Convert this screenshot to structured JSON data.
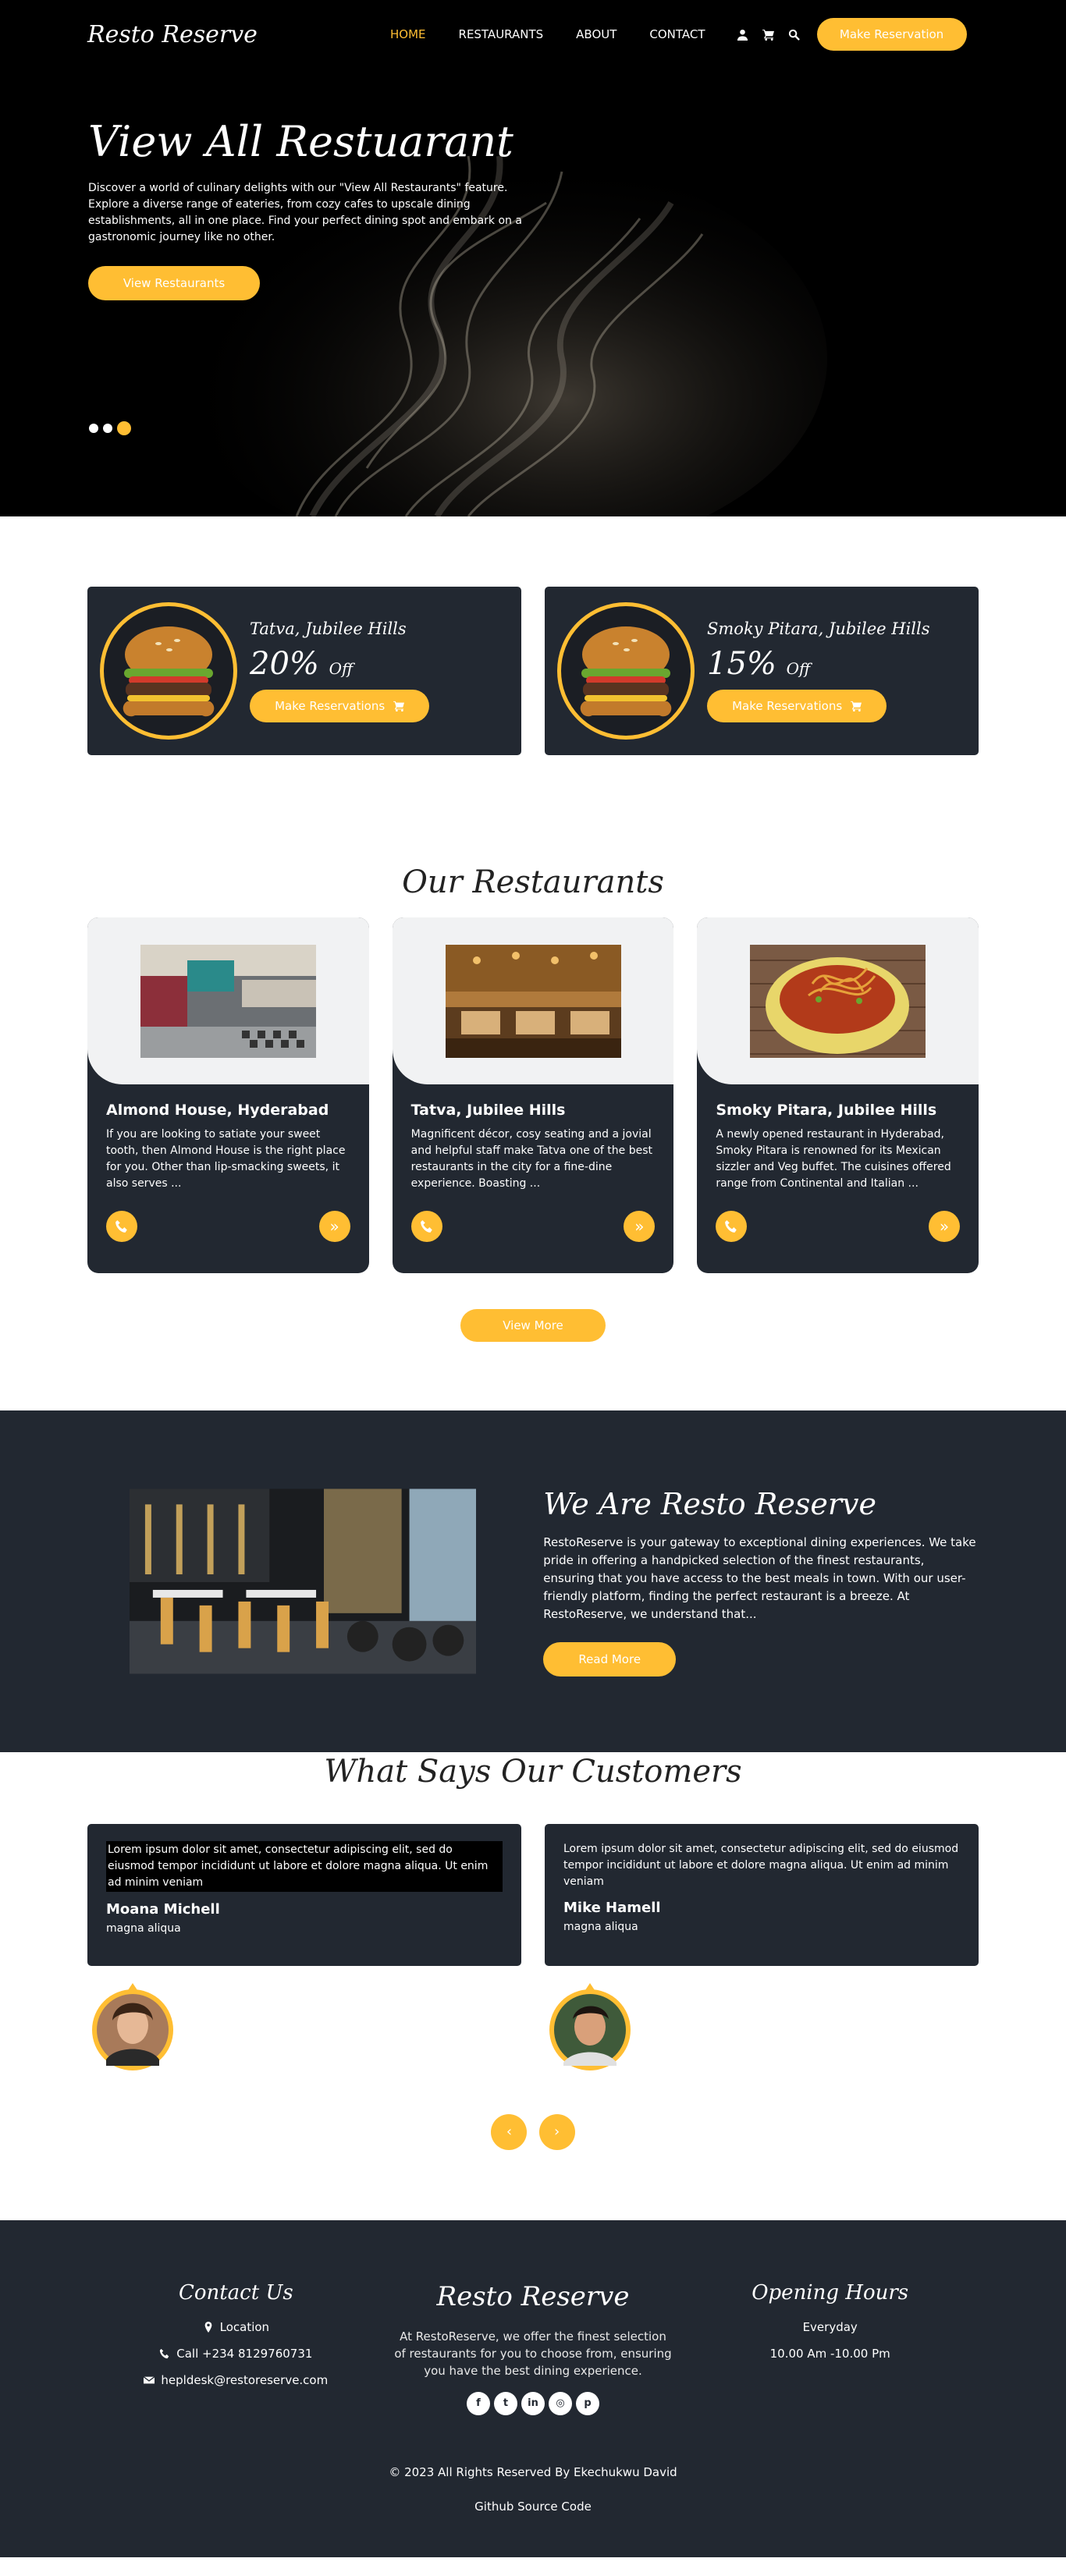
{
  "nav": {
    "brand": "Resto Reserve",
    "items": [
      "HOME",
      "RESTAURANTS",
      "ABOUT",
      "CONTACT"
    ],
    "icons": [
      "user-icon",
      "cart-icon",
      "search-icon"
    ],
    "cta": "Make Reservation"
  },
  "hero": {
    "title": "View All Restuarant",
    "text": "Discover a world of culinary delights with our \"View All Restaurants\" feature. Explore a diverse range of eateries, from cozy cafes to upscale dining establishments, all in one place. Find your perfect dining spot and embark on a gastronomic journey like no other.",
    "button": "View Restaurants",
    "active_dot": 3
  },
  "offers": [
    {
      "place": "Tatva, Jubilee Hills",
      "discount": "20%",
      "off": "Off",
      "button": "Make Reservations"
    },
    {
      "place": "Smoky Pitara, Jubilee Hills",
      "discount": "15%",
      "off": "Off",
      "button": "Make Reservations"
    }
  ],
  "restaurants": {
    "title": "Our Restaurants",
    "items": [
      {
        "name": "Almond House, Hyderabad",
        "desc": "If you are looking to satiate your sweet tooth, then Almond House is the right place for you. Other than lip-smacking sweets, it also serves ..."
      },
      {
        "name": "Tatva, Jubilee Hills",
        "desc": "Magnificent décor, cosy seating and a jovial and helpful staff make Tatva one of the best restaurants in the city for a fine-dine experience. Boasting ..."
      },
      {
        "name": "Smoky Pitara, Jubilee Hills",
        "desc": "A newly opened restaurant in Hyderabad, Smoky Pitara is renowned for its Mexican sizzler and Veg buffet. The cuisines offered range from Continental and Italian ..."
      }
    ],
    "view_more": "View More"
  },
  "about": {
    "title": "We Are Resto Reserve",
    "text": "RestoReserve is your gateway to exceptional dining experiences. We take pride in offering a handpicked selection of the finest restaurants, ensuring that you have access to the best meals in town. With our user-friendly platform, finding the perfect restaurant is a breeze. At RestoReserve, we understand that...",
    "button": "Read More"
  },
  "testimonials": {
    "title": "What Says Our Customers",
    "items": [
      {
        "text": "Lorem ipsum dolor sit amet, consectetur adipiscing elit, sed do eiusmod tempor incididunt ut labore et dolore magna aliqua. Ut enim ad minim veniam",
        "name": "Moana Michell",
        "sub": "magna aliqua"
      },
      {
        "text": "Lorem ipsum dolor sit amet, consectetur adipiscing elit, sed do eiusmod tempor incididunt ut labore et dolore magna aliqua. Ut enim ad minim veniam",
        "name": "Mike Hamell",
        "sub": "magna aliqua"
      }
    ],
    "prev": "‹",
    "next": "›"
  },
  "footer": {
    "contact_title": "Contact Us",
    "location": "Location",
    "phone": "Call +234 8129760731",
    "email": "hepldesk@restoreserve.com",
    "brand": "Resto Reserve",
    "about": "At RestoReserve, we offer the finest selection of restaurants for you to choose from, ensuring you have the best dining experience.",
    "social": [
      "facebook-icon",
      "twitter-icon",
      "linkedin-icon",
      "instagram-icon",
      "pinterest-icon"
    ],
    "social_glyphs": [
      "f",
      "t",
      "in",
      "◎",
      "p"
    ],
    "hours_title": "Opening Hours",
    "hours_day": "Everyday",
    "hours_time": "10.00 Am -10.00 Pm",
    "copyright": "© 2023 All Rights Reserved By Ekechukwu David",
    "source": "Github Source Code"
  },
  "colors": {
    "accent": "#ffbe33",
    "dark": "#222831"
  }
}
